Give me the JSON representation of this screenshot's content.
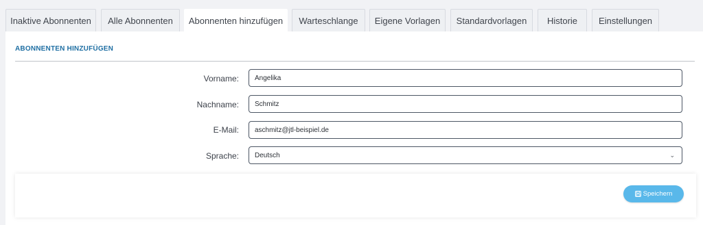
{
  "tabs": [
    {
      "label": "Inaktive Abonnenten"
    },
    {
      "label": "Alle Abonnenten"
    },
    {
      "label": "Abonnenten hinzufügen",
      "active": true
    },
    {
      "label": "Warteschlange"
    },
    {
      "label": "Eigene Vorlagen"
    },
    {
      "label": "Standardvorlagen"
    },
    {
      "label": "Historie"
    },
    {
      "label": "Einstellungen"
    }
  ],
  "section": {
    "title": "ABONNENTEN HINZUFÜGEN"
  },
  "form": {
    "firstname": {
      "label": "Vorname:",
      "value": "Angelika"
    },
    "lastname": {
      "label": "Nachname:",
      "value": "Schmitz"
    },
    "email": {
      "label": "E-Mail:",
      "value": "aschmitz@jtl-beispiel.de"
    },
    "language": {
      "label": "Sprache:",
      "value": "Deutsch"
    }
  },
  "actions": {
    "save_label": "Speichern",
    "save_icon": "floppy-disk-icon"
  },
  "colors": {
    "accent": "#1f6fa3",
    "button": "#59b8ea",
    "background": "#f1f2f5"
  }
}
